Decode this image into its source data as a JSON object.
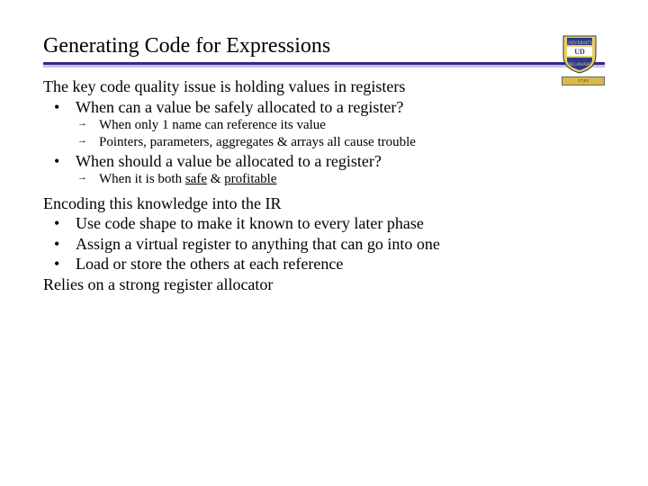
{
  "title": "Generating Code for Expressions",
  "logo": {
    "alt": "University of Delaware shield"
  },
  "section1": {
    "intro": "The key code quality issue is holding values in registers",
    "bullets": [
      "When can a value be safely allocated to a register?"
    ],
    "subs1": [
      "When only 1 name can reference its value",
      "Pointers, parameters, aggregates & arrays all cause trouble"
    ],
    "bullets2": [
      "When should a value be allocated to a register?"
    ],
    "subs2_prefix": "When it is both ",
    "subs2_word1": "safe",
    "subs2_mid": " & ",
    "subs2_word2": "profitable"
  },
  "section2": {
    "intro": "Encoding this knowledge into the IR",
    "bullets": [
      "Use code shape to make it known to every later phase",
      "Assign a virtual register to anything that can go into one",
      "Load or store the others at each reference"
    ],
    "outro": "Relies on a strong register allocator"
  }
}
